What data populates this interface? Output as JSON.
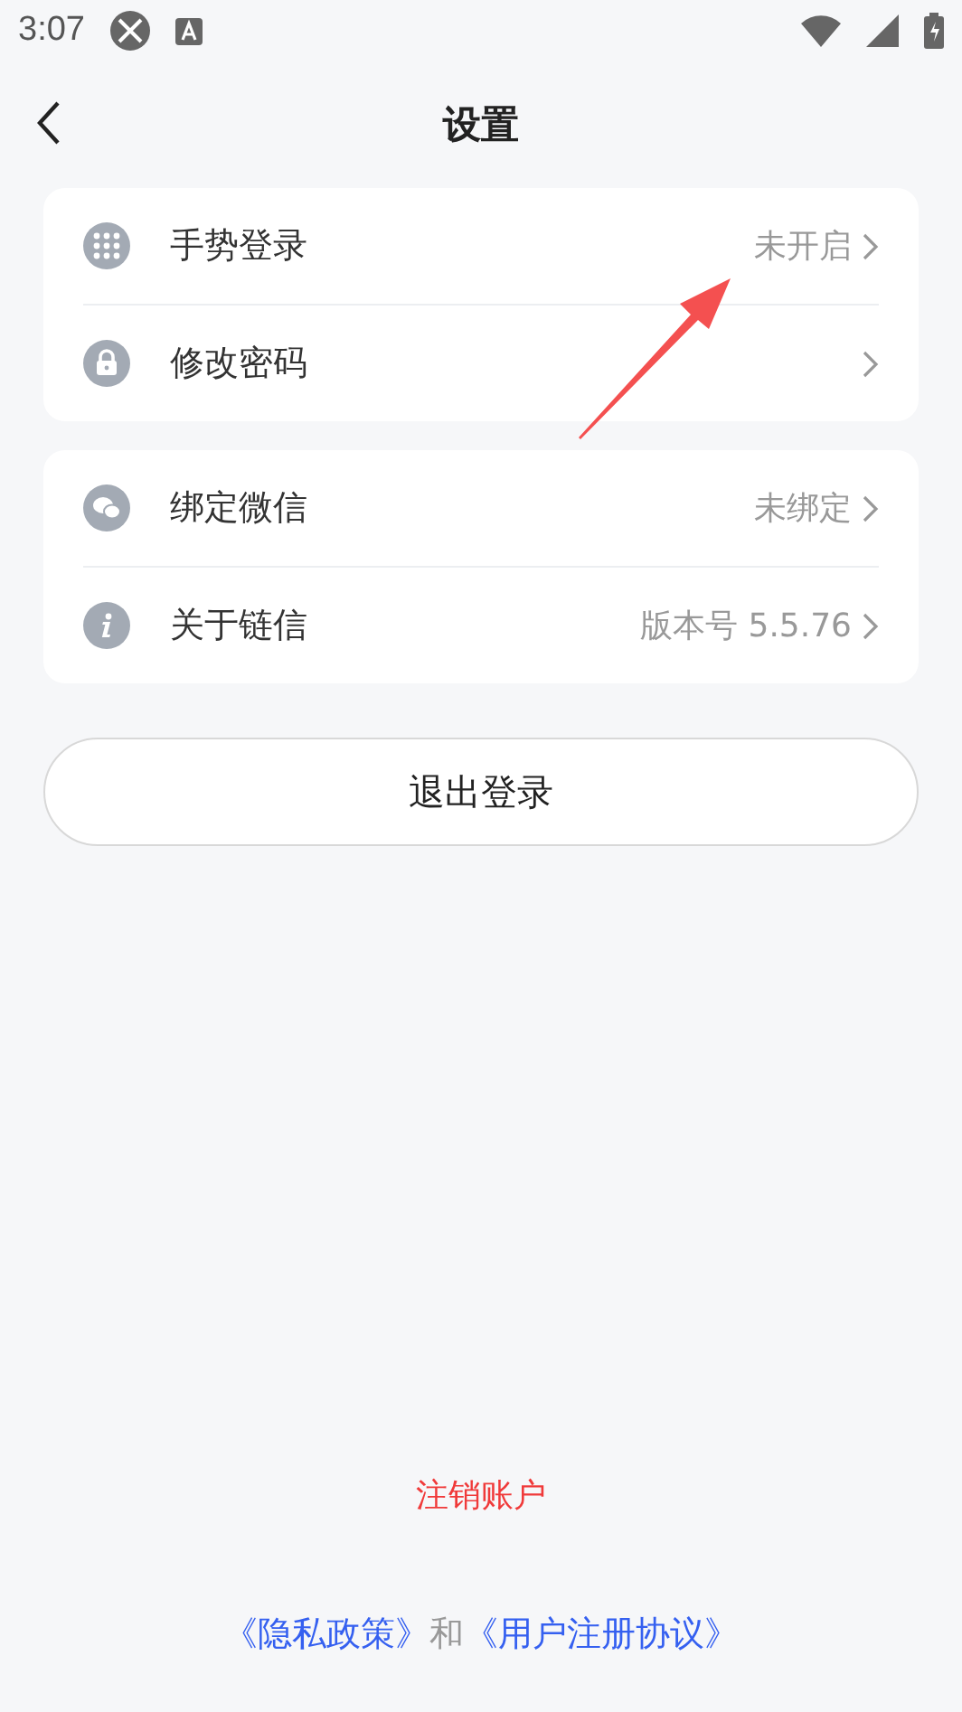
{
  "status_bar": {
    "time": "3:07"
  },
  "header": {
    "title": "设置"
  },
  "groups": [
    {
      "rows": [
        {
          "kind": "grid",
          "label": "手势登录",
          "value": "未开启"
        },
        {
          "kind": "lock",
          "label": "修改密码"
        }
      ]
    },
    {
      "rows": [
        {
          "kind": "chat",
          "label": "绑定微信",
          "value": "未绑定"
        },
        {
          "kind": "info",
          "label": "关于链信",
          "value": "版本号 5.5.76"
        }
      ]
    }
  ],
  "logout_button": "退出登录",
  "delete_account": "注销账户",
  "footer": {
    "links": [
      "《隐私政策》",
      "《用户注册协议》"
    ],
    "joiner": "和"
  }
}
